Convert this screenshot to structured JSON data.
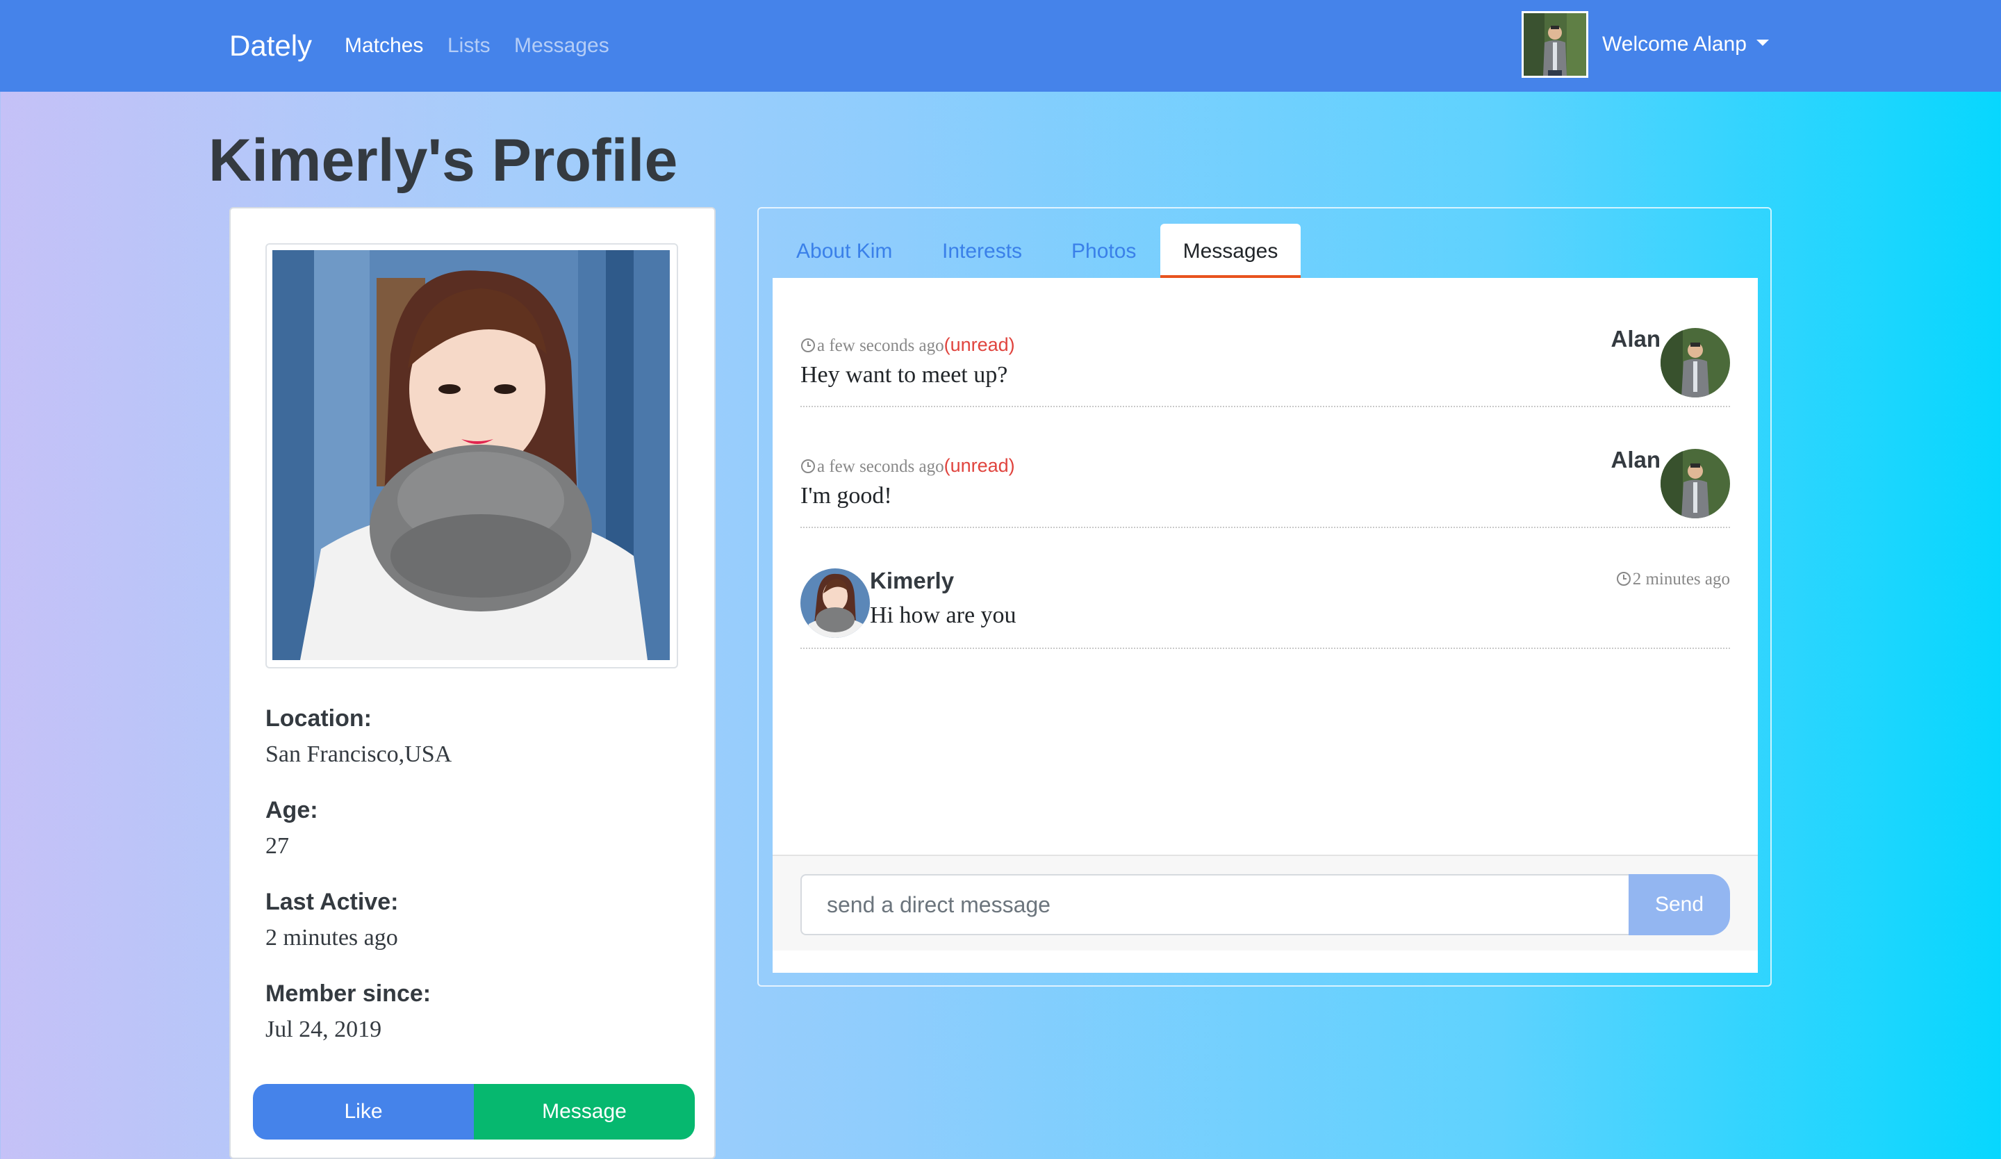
{
  "navbar": {
    "brand": "Dately",
    "links": [
      "Matches",
      "Lists",
      "Messages"
    ],
    "active_link": "Matches",
    "welcome": "Welcome Alanp"
  },
  "page": {
    "title": "Kimerly's Profile"
  },
  "profile": {
    "location_label": "Location:",
    "location": "San Francisco,USA",
    "age_label": "Age:",
    "age": "27",
    "last_active_label": "Last Active:",
    "last_active": "2 minutes ago",
    "member_since_label": "Member since:",
    "member_since": "Jul 24, 2019",
    "like_label": "Like",
    "message_label": "Message"
  },
  "tabs": [
    {
      "label": "About Kim"
    },
    {
      "label": "Interests"
    },
    {
      "label": "Photos"
    },
    {
      "label": "Messages"
    }
  ],
  "active_tab": "Messages",
  "messages": [
    {
      "sender": "Alan",
      "time": "a few seconds ago",
      "status": "(unread)",
      "text": "Hey want to meet up?",
      "side": "right"
    },
    {
      "sender": "Alan",
      "time": "a few seconds ago",
      "status": "(unread)",
      "text": "I'm good!",
      "side": "right"
    },
    {
      "sender": "Kimerly",
      "time": "2 minutes ago",
      "status": "",
      "text": "Hi how are you",
      "side": "left"
    }
  ],
  "composer": {
    "placeholder": "send a direct message",
    "send_label": "Send"
  },
  "colors": {
    "navbar": "#4583ea",
    "like_button": "#4583ea",
    "message_button": "#06b86f",
    "active_tab_underline": "#e8531e",
    "unread": "#e0443e",
    "send_button": "#93b6f1"
  }
}
